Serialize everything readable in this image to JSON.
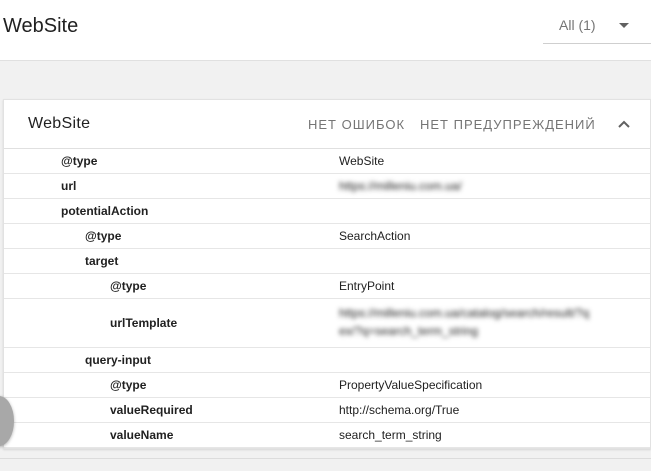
{
  "header": {
    "title": "WebSite",
    "filter_value": "All (1)"
  },
  "card": {
    "title": "WebSite",
    "errors_label": "НЕТ ОШИБОК",
    "warnings_label": "НЕТ ПРЕДУПРЕЖДЕНИЙ"
  },
  "rows": [
    {
      "key": "@type",
      "value": "WebSite"
    },
    {
      "key": "url",
      "value": "https://milleniu.com.ua/"
    },
    {
      "key": "potentialAction",
      "value": ""
    },
    {
      "key": "@type",
      "value": "SearchAction"
    },
    {
      "key": "target",
      "value": ""
    },
    {
      "key": "@type",
      "value": "EntryPoint"
    },
    {
      "key": "urlTemplate",
      "value_line1": "https://milleniu.com.ua/catalog/search/result/?q",
      "value_line2": "ex/?q=search_term_string"
    },
    {
      "key": "query-input",
      "value": ""
    },
    {
      "key": "@type",
      "value": "PropertyValueSpecification"
    },
    {
      "key": "valueRequired",
      "value": "http://schema.org/True"
    },
    {
      "key": "valueName",
      "value": "search_term_string"
    }
  ]
}
